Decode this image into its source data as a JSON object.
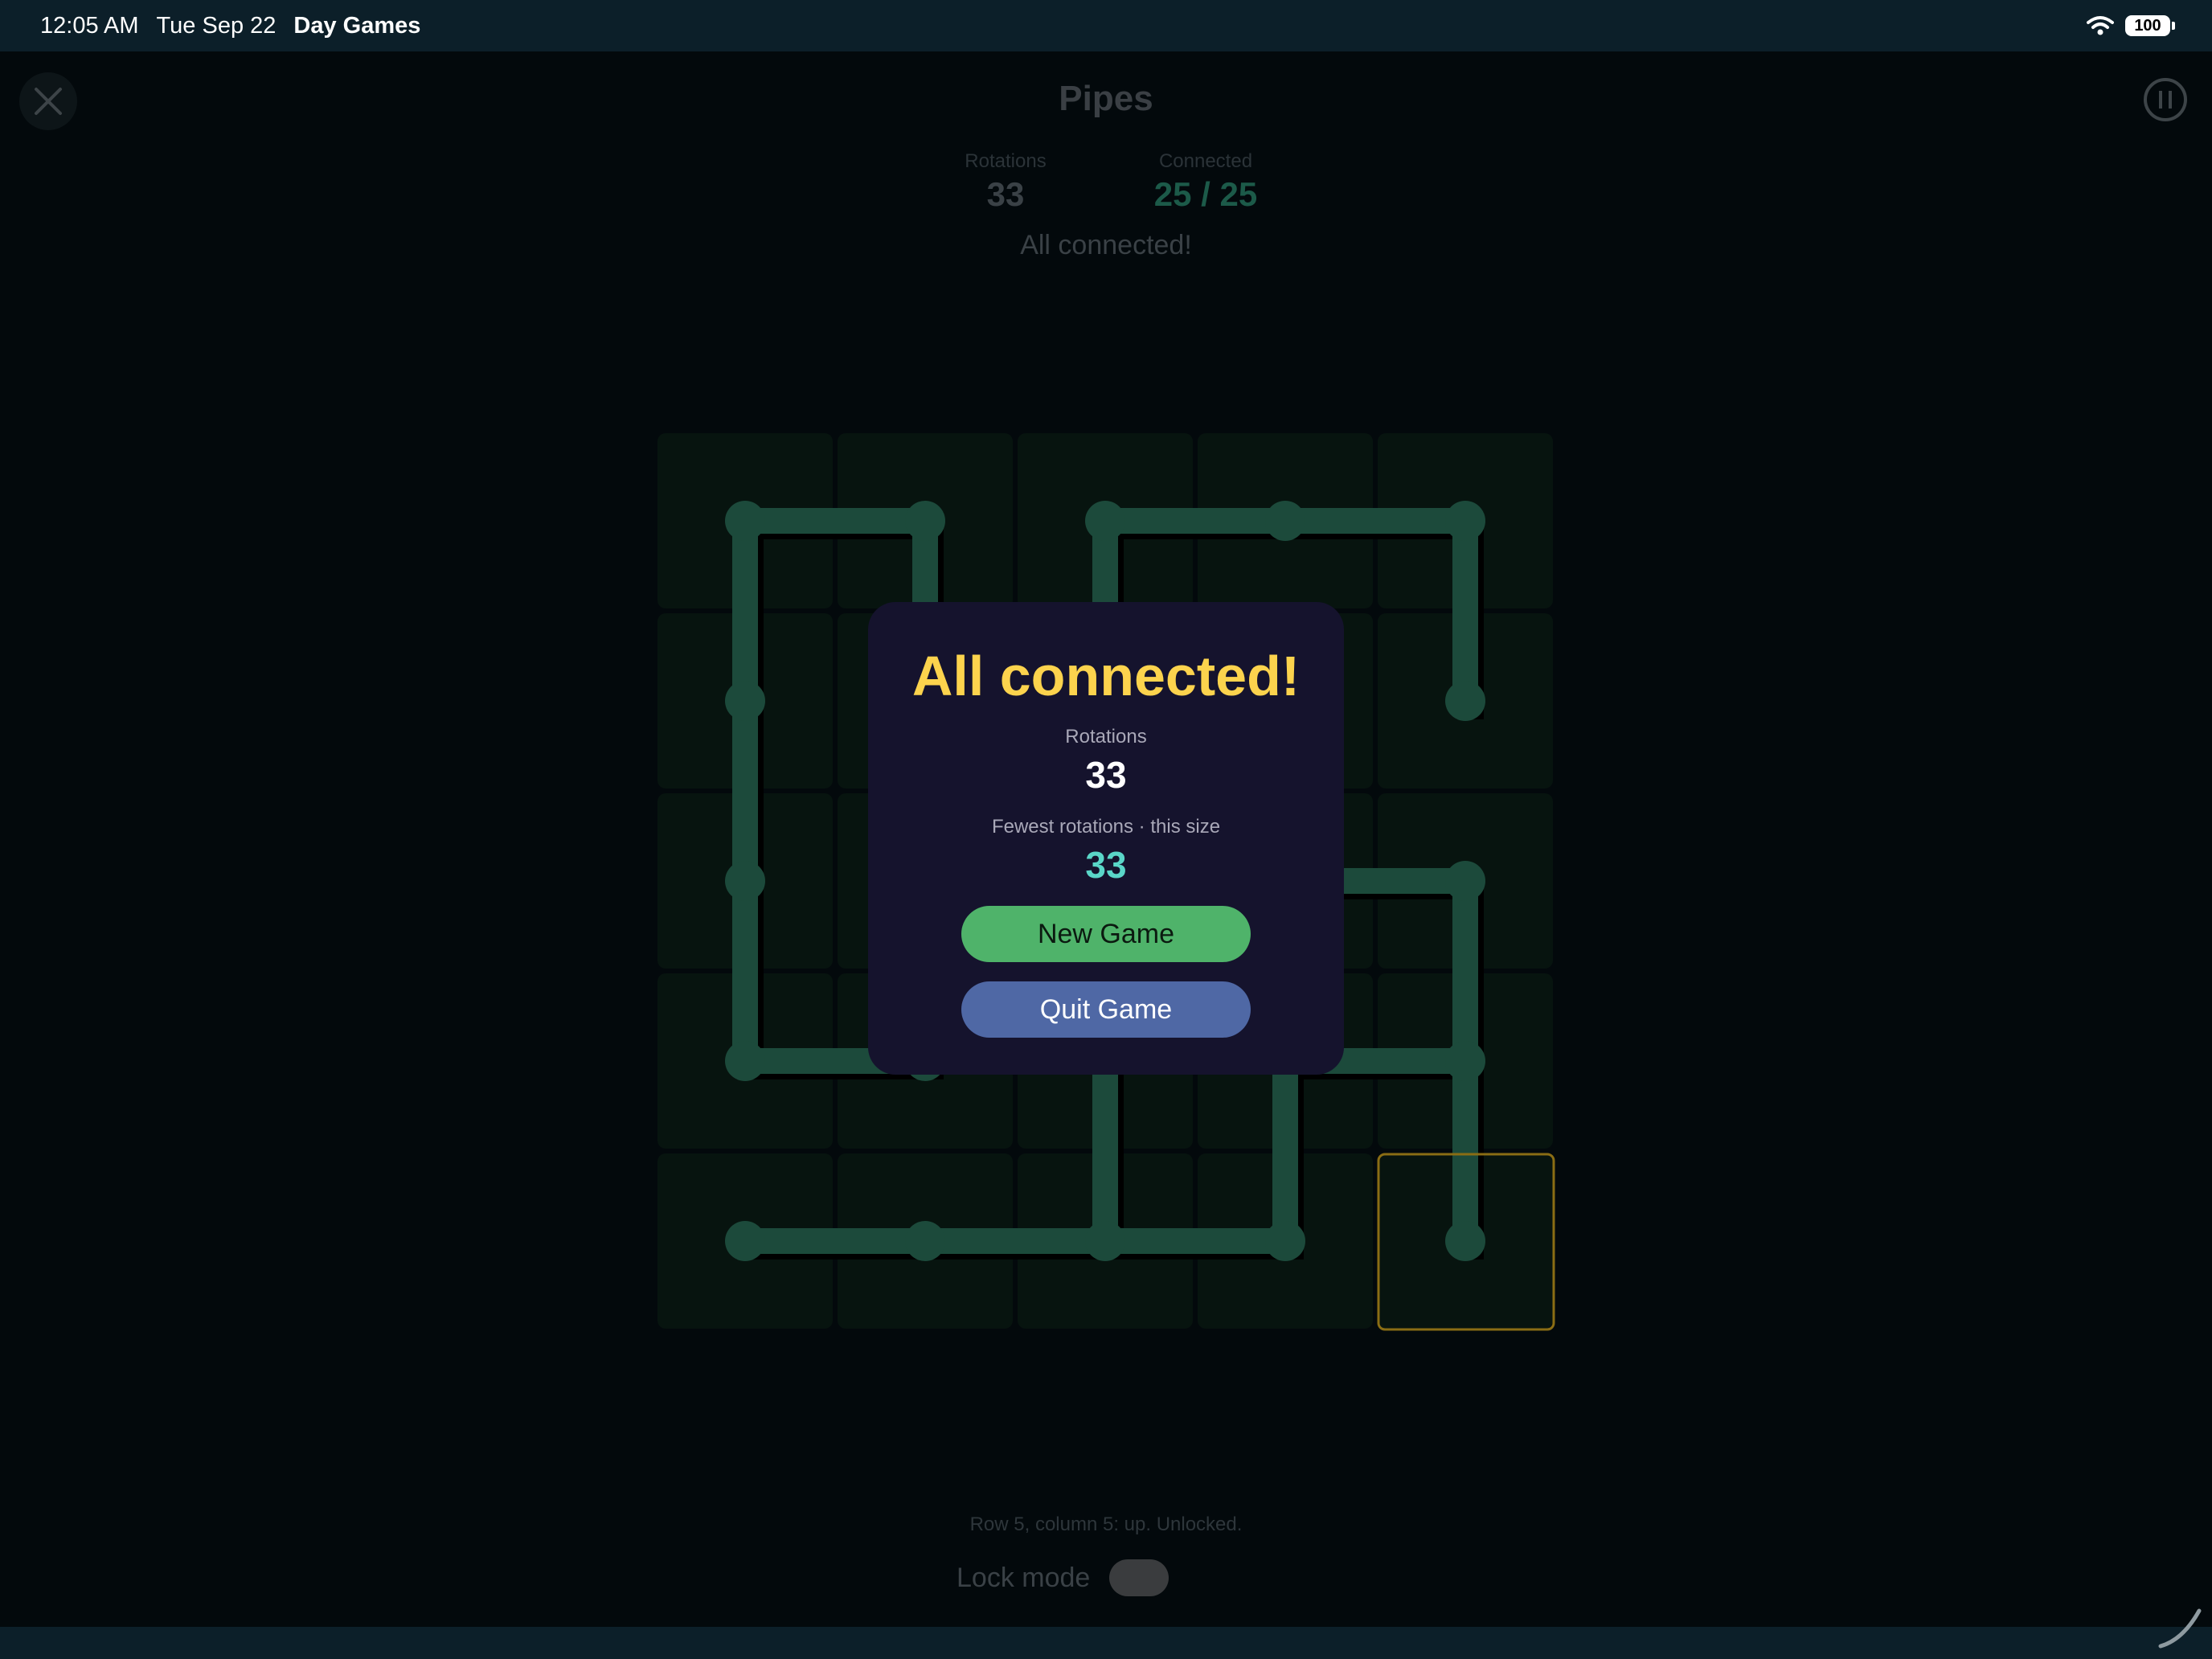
{
  "status_bar": {
    "time": "12:05 AM",
    "date": "Tue Sep 22",
    "app_name": "Day Games",
    "battery": "100"
  },
  "header": {
    "title": "Pipes",
    "close_icon": "close-icon",
    "pause_icon": "pause-icon"
  },
  "stats": {
    "rotations_label": "Rotations",
    "rotations_value": "33",
    "connected_label": "Connected",
    "connected_value": "25 / 25"
  },
  "status_message": "All connected!",
  "board": {
    "rows": 5,
    "cols": 5,
    "selected_cell": [
      5,
      5
    ],
    "colors": {
      "tile": "#07140f",
      "pipe": "#1c4a3b",
      "pipe_shadow": "#000000",
      "highlight": "#8a6d14"
    }
  },
  "footer": {
    "cell_status": "Row 5, column 5: up. Unlocked.",
    "lock_mode_label": "Lock mode",
    "lock_mode_on": false
  },
  "dialog": {
    "title": "All connected!",
    "rotations_label": "Rotations",
    "rotations_value": "33",
    "best_label": "Fewest rotations · this size",
    "best_value": "33",
    "new_game_label": "New Game",
    "quit_game_label": "Quit Game"
  },
  "colors": {
    "accent_yellow": "#fcd34d",
    "accent_teal": "#5ad6c8",
    "connected_green": "#1c5a49",
    "new_game_green": "#4fb36a",
    "quit_blue": "#4f68a5"
  }
}
